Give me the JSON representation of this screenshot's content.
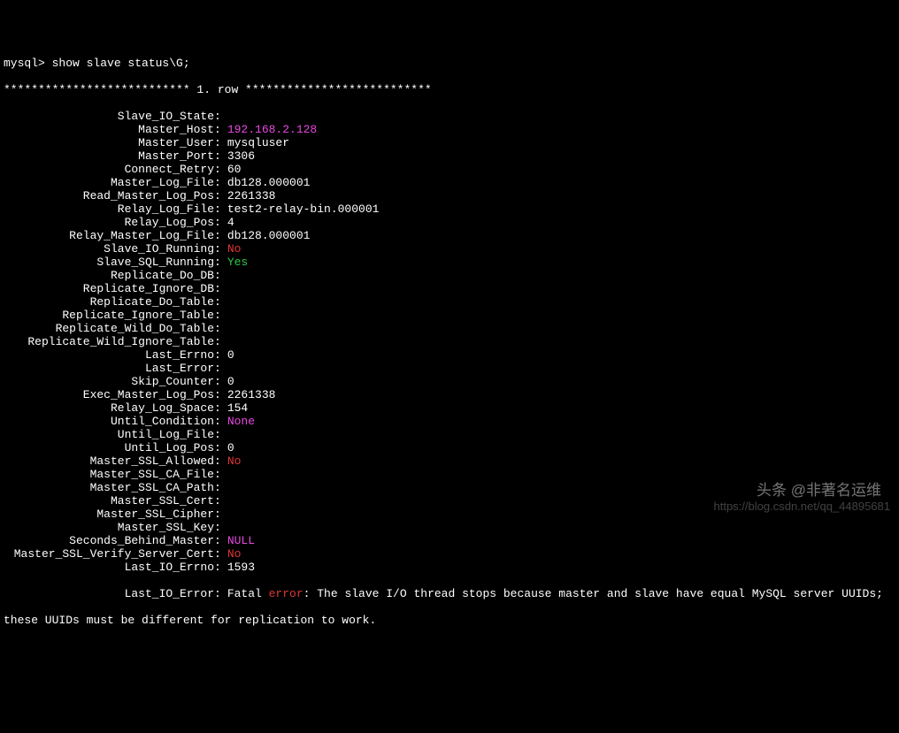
{
  "prompt": "mysql> ",
  "command": "show slave status\\G;",
  "header": "*************************** 1. row ***************************",
  "rows": [
    {
      "label": "Slave_IO_State",
      "value": "",
      "color": "white"
    },
    {
      "label": "Master_Host",
      "value": "192.168.2.128",
      "color": "magenta"
    },
    {
      "label": "Master_User",
      "value": "mysqluser",
      "color": "white"
    },
    {
      "label": "Master_Port",
      "value": "3306",
      "color": "white"
    },
    {
      "label": "Connect_Retry",
      "value": "60",
      "color": "white"
    },
    {
      "label": "Master_Log_File",
      "value": "db128.000001",
      "color": "white"
    },
    {
      "label": "Read_Master_Log_Pos",
      "value": "2261338",
      "color": "white"
    },
    {
      "label": "Relay_Log_File",
      "value": "test2-relay-bin.000001",
      "color": "white"
    },
    {
      "label": "Relay_Log_Pos",
      "value": "4",
      "color": "white"
    },
    {
      "label": "Relay_Master_Log_File",
      "value": "db128.000001",
      "color": "white"
    },
    {
      "label": "Slave_IO_Running",
      "value": "No",
      "color": "red"
    },
    {
      "label": "Slave_SQL_Running",
      "value": "Yes",
      "color": "green"
    },
    {
      "label": "Replicate_Do_DB",
      "value": "",
      "color": "white"
    },
    {
      "label": "Replicate_Ignore_DB",
      "value": "",
      "color": "white"
    },
    {
      "label": "Replicate_Do_Table",
      "value": "",
      "color": "white"
    },
    {
      "label": "Replicate_Ignore_Table",
      "value": "",
      "color": "white"
    },
    {
      "label": "Replicate_Wild_Do_Table",
      "value": "",
      "color": "white"
    },
    {
      "label": "Replicate_Wild_Ignore_Table",
      "value": "",
      "color": "white"
    },
    {
      "label": "Last_Errno",
      "value": "0",
      "color": "white"
    },
    {
      "label": "Last_Error",
      "value": "",
      "color": "white"
    },
    {
      "label": "Skip_Counter",
      "value": "0",
      "color": "white"
    },
    {
      "label": "Exec_Master_Log_Pos",
      "value": "2261338",
      "color": "white"
    },
    {
      "label": "Relay_Log_Space",
      "value": "154",
      "color": "white"
    },
    {
      "label": "Until_Condition",
      "value": "None",
      "color": "magenta"
    },
    {
      "label": "Until_Log_File",
      "value": "",
      "color": "white"
    },
    {
      "label": "Until_Log_Pos",
      "value": "0",
      "color": "white"
    },
    {
      "label": "Master_SSL_Allowed",
      "value": "No",
      "color": "red"
    },
    {
      "label": "Master_SSL_CA_File",
      "value": "",
      "color": "white"
    },
    {
      "label": "Master_SSL_CA_Path",
      "value": "",
      "color": "white"
    },
    {
      "label": "Master_SSL_Cert",
      "value": "",
      "color": "white"
    },
    {
      "label": "Master_SSL_Cipher",
      "value": "",
      "color": "white"
    },
    {
      "label": "Master_SSL_Key",
      "value": "",
      "color": "white"
    },
    {
      "label": "Seconds_Behind_Master",
      "value": "NULL",
      "color": "magenta"
    },
    {
      "label": "Master_SSL_Verify_Server_Cert",
      "value": "No",
      "color": "red"
    },
    {
      "label": "Last_IO_Errno",
      "value": "1593",
      "color": "white"
    }
  ],
  "error_row": {
    "label": "Last_IO_Error",
    "pre": "Fatal ",
    "word": "error",
    "post": ": The slave I/O thread stops because master and slave have equal MySQL server UUIDs;"
  },
  "error_cont": "these UUIDs must be different for replication to work.",
  "watermark1": "头条 @非著名运维",
  "watermark2": "https://blog.csdn.net/qq_44895681"
}
